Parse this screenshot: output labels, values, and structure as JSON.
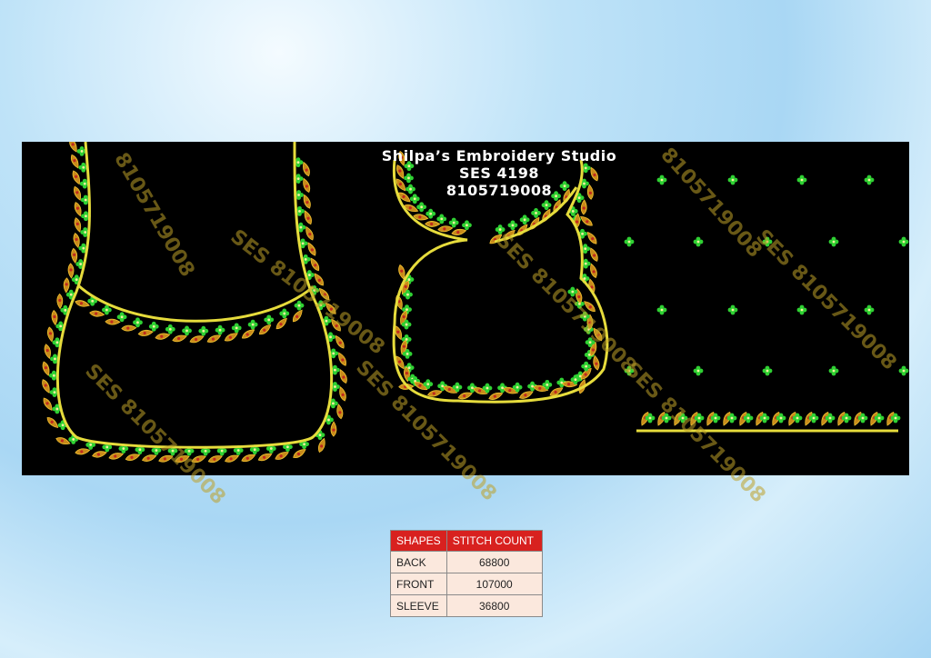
{
  "studio": {
    "name": "Shilpa’s Embroidery Studio",
    "design_code": "SES  4198",
    "phone": "8105719008"
  },
  "watermark": {
    "text_full": "SES 8105719008",
    "text_partial": "8105719008"
  },
  "colors": {
    "background": "#000000",
    "outline": "#e6dc3c",
    "leaf": "#c88a1a",
    "flower": "#2fd133",
    "header_red": "#d8211f",
    "cell_bg": "#fbe8dd"
  },
  "table": {
    "headers": [
      "SHAPES",
      "STITCH COUNT"
    ],
    "rows": [
      {
        "shape": "BACK",
        "count": "68800"
      },
      {
        "shape": "FRONT",
        "count": "107000"
      },
      {
        "shape": "SLEEVE",
        "count": "36800"
      }
    ]
  }
}
